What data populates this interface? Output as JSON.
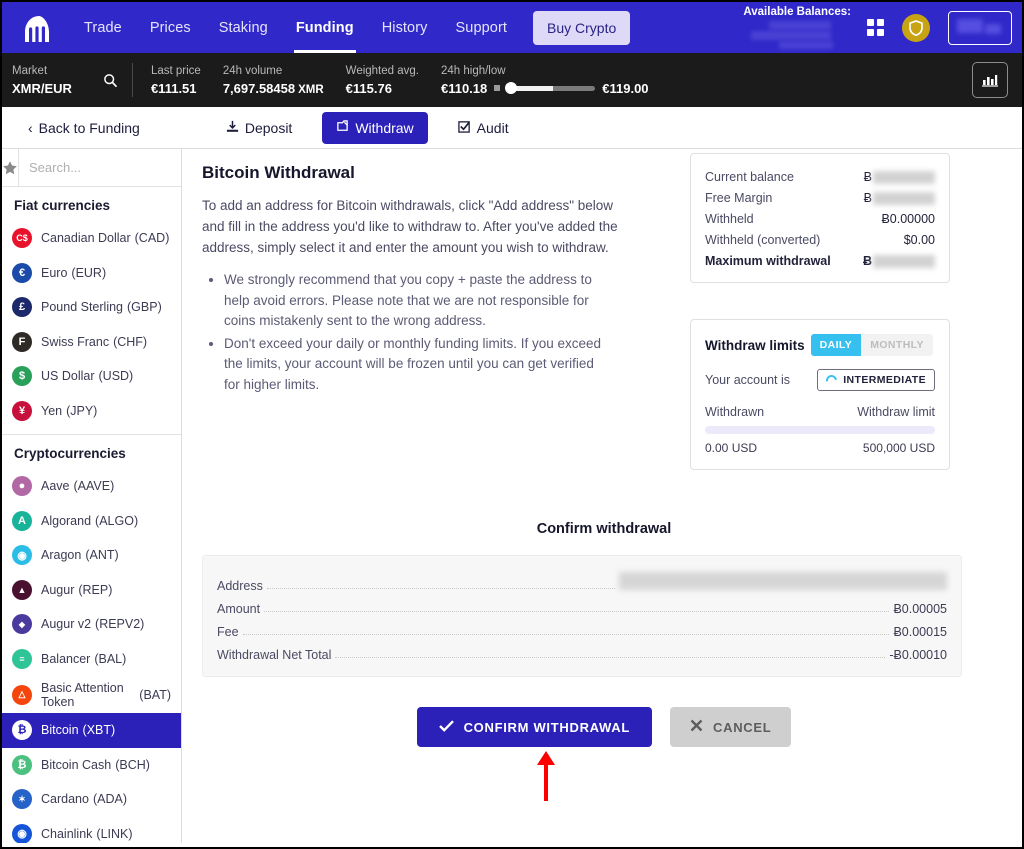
{
  "topnav": {
    "logo_icon": "kraken-logo-icon",
    "links": [
      {
        "label": "Trade",
        "active": false
      },
      {
        "label": "Prices",
        "active": false
      },
      {
        "label": "Staking",
        "active": false
      },
      {
        "label": "Funding",
        "active": true
      },
      {
        "label": "History",
        "active": false
      },
      {
        "label": "Support",
        "active": false
      }
    ],
    "buy_crypto": "Buy Crypto",
    "available_balances_label": "Available Balances:",
    "apps_icon": "grid-apps-icon",
    "security_icon": "shield-icon",
    "account_icon": "account-box-icon"
  },
  "marketbar": {
    "market_label": "Market",
    "market_pair": "XMR/EUR",
    "search_icon": "search-icon",
    "stats": [
      {
        "label": "Last price",
        "value": "€111.51",
        "unit": ""
      },
      {
        "label": "24h volume",
        "value": "7,697.58458",
        "unit": "XMR"
      },
      {
        "label": "Weighted avg.",
        "value": "€115.76",
        "unit": ""
      }
    ],
    "high_low_label": "24h high/low",
    "low": "€110.18",
    "high": "€119.00",
    "chart_icon": "bar-chart-icon"
  },
  "subnav": {
    "back": "Back to Funding",
    "back_icon": "chevron-left-icon",
    "deposit": "Deposit",
    "deposit_icon": "download-icon",
    "withdraw": "Withdraw",
    "withdraw_icon": "upload-icon",
    "audit": "Audit",
    "audit_icon": "check-square-icon"
  },
  "sidebar": {
    "favorite_icon": "star-icon",
    "search_placeholder": "Search...",
    "search_value": "",
    "search_icon": "search-icon",
    "fiat_title": "Fiat currencies",
    "fiat": [
      {
        "name": "Canadian Dollar",
        "code": "(CAD)",
        "glyph": "C$",
        "color": "#e8122a"
      },
      {
        "name": "Euro",
        "code": "(EUR)",
        "glyph": "€",
        "color": "#1b4ba8"
      },
      {
        "name": "Pound Sterling",
        "code": "(GBP)",
        "glyph": "£",
        "color": "#1c2a6b"
      },
      {
        "name": "Swiss Franc",
        "code": "(CHF)",
        "glyph": "F",
        "color": "#2e2a26"
      },
      {
        "name": "US Dollar",
        "code": "(USD)",
        "glyph": "$",
        "color": "#29a05a"
      },
      {
        "name": "Yen",
        "code": "(JPY)",
        "glyph": "¥",
        "color": "#c8103c"
      }
    ],
    "crypto_title": "Cryptocurrencies",
    "crypto": [
      {
        "name": "Aave",
        "code": "(AAVE)",
        "glyph": "●",
        "color": "#b368a6",
        "selected": false
      },
      {
        "name": "Algorand",
        "code": "(ALGO)",
        "glyph": "A",
        "color": "#18b49a",
        "selected": false
      },
      {
        "name": "Aragon",
        "code": "(ANT)",
        "glyph": "◉",
        "color": "#2bbde6",
        "selected": false
      },
      {
        "name": "Augur",
        "code": "(REP)",
        "glyph": "▲",
        "color": "#4a1030",
        "selected": false
      },
      {
        "name": "Augur v2",
        "code": "(REPV2)",
        "glyph": "◆",
        "color": "#4a3a9e",
        "selected": false
      },
      {
        "name": "Balancer",
        "code": "(BAL)",
        "glyph": "≡",
        "color": "#2ec496",
        "selected": false
      },
      {
        "name": "Basic Attention Token",
        "code": "(BAT)",
        "glyph": "△",
        "color": "#f4460c",
        "selected": false
      },
      {
        "name": "Bitcoin",
        "code": "(XBT)",
        "glyph": "Ƀ",
        "color": "#ffffff",
        "selected": true
      },
      {
        "name": "Bitcoin Cash",
        "code": "(BCH)",
        "glyph": "₿",
        "color": "#4cc07e",
        "selected": false
      },
      {
        "name": "Cardano",
        "code": "(ADA)",
        "glyph": "✶",
        "color": "#2563c8",
        "selected": false
      },
      {
        "name": "Chainlink",
        "code": "(LINK)",
        "glyph": "◉",
        "color": "#1454d8",
        "selected": false
      }
    ]
  },
  "main": {
    "title": "Bitcoin Withdrawal",
    "intro": "To add an address for Bitcoin withdrawals, click \"Add address\" below and fill in the address you'd like to withdraw to. After you've added the address, simply select it and enter the amount you wish to withdraw.",
    "bullets": [
      "We strongly recommend that you copy + paste the address to help avoid errors. Please note that we are not responsible for coins mistakenly sent to the wrong address.",
      "Don't exceed your daily or monthly funding limits. If you exceed the limits, your account will be frozen until you can get verified for higher limits."
    ]
  },
  "balance_panel": {
    "rows": [
      {
        "label": "Current balance",
        "value": "Ƀ",
        "blurred": true
      },
      {
        "label": "Free Margin",
        "value": "Ƀ",
        "blurred": true
      },
      {
        "label": "Withheld",
        "value": "Ƀ0.00000",
        "blurred": false
      },
      {
        "label": "Withheld (converted)",
        "value": "$0.00",
        "blurred": false
      },
      {
        "label": "Maximum withdrawal",
        "value": "Ƀ",
        "blurred": true,
        "bold": true
      }
    ]
  },
  "limits_panel": {
    "title": "Withdraw limits",
    "daily": "DAILY",
    "monthly": "MONTHLY",
    "active_period": "DAILY",
    "account_label": "Your account is",
    "tier": "INTERMEDIATE",
    "tier_icon": "loading-ring-icon",
    "withdrawn_label": "Withdrawn",
    "limit_label": "Withdraw limit",
    "withdrawn_value": "0.00",
    "withdrawn_currency": "USD",
    "limit_value": "500,000",
    "limit_currency": "USD",
    "progress_percent": 0
  },
  "confirm": {
    "title": "Confirm withdrawal",
    "rows": [
      {
        "label": "Address",
        "value": "",
        "blurred": true
      },
      {
        "label": "Amount",
        "value": "Ƀ0.00005",
        "blurred": false
      },
      {
        "label": "Fee",
        "value": "Ƀ0.00015",
        "blurred": false
      },
      {
        "label": "Withdrawal Net Total",
        "value": "-Ƀ0.00010",
        "blurred": false
      }
    ],
    "confirm_button": "CONFIRM WITHDRAWAL",
    "confirm_icon": "check-icon",
    "cancel_button": "CANCEL",
    "cancel_icon": "x-icon",
    "annotation_icon": "red-arrow-up-annotation"
  },
  "colors": {
    "brand_blue": "#2b21b8",
    "nav_blue": "#3028c8",
    "accent_cyan": "#35c0f0",
    "annotation_red": "#ff0000"
  }
}
